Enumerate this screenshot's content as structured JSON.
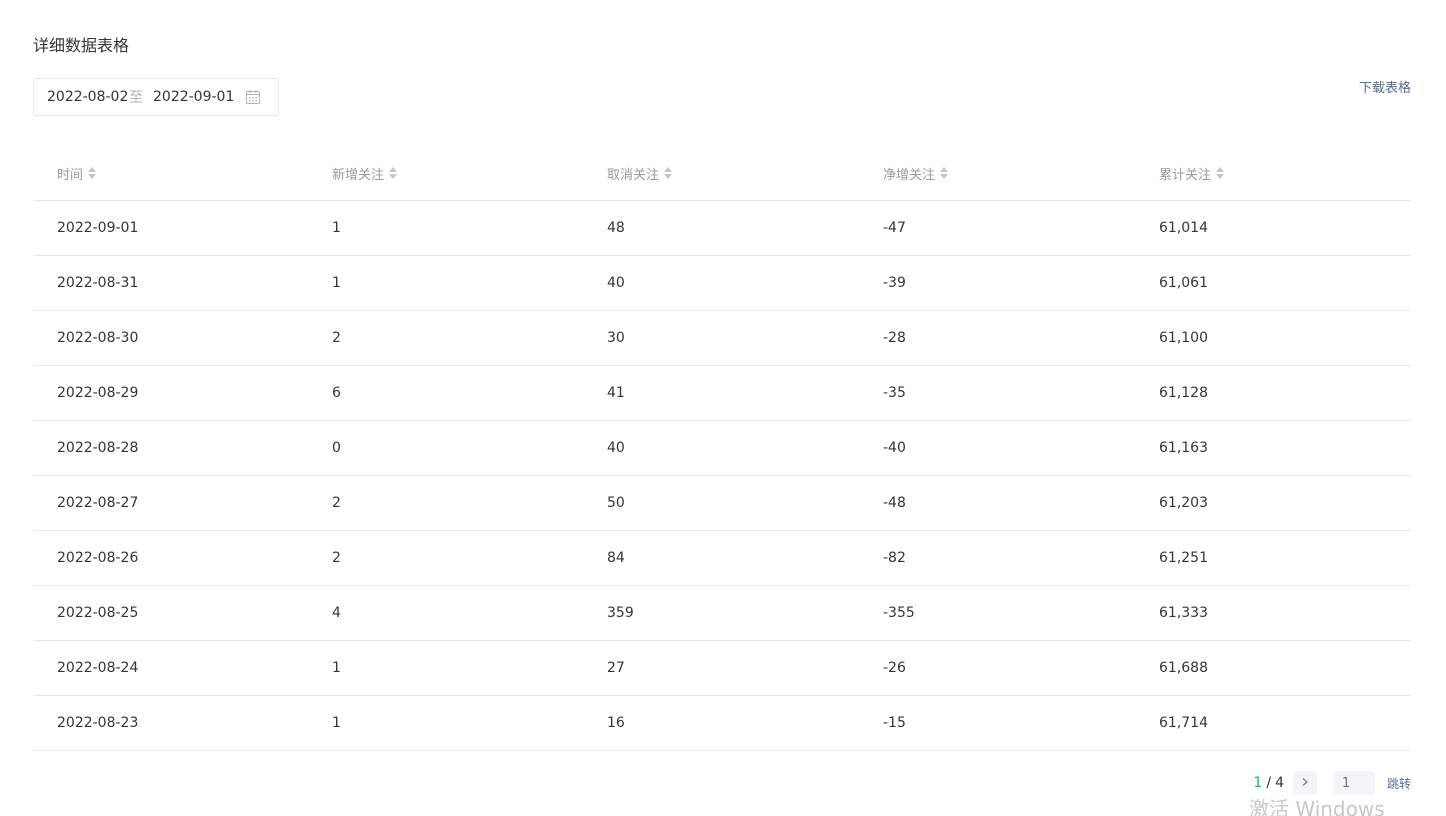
{
  "section": {
    "title": "详细数据表格"
  },
  "date_range": {
    "start": "2022-08-02",
    "separator": "至",
    "end": "2022-09-01",
    "icon": "calendar-icon"
  },
  "actions": {
    "download_label": "下载表格"
  },
  "table": {
    "columns": [
      "时间",
      "新增关注",
      "取消关注",
      "净增关注",
      "累计关注"
    ],
    "rows": [
      [
        "2022-09-01",
        "1",
        "48",
        "-47",
        "61,014"
      ],
      [
        "2022-08-31",
        "1",
        "40",
        "-39",
        "61,061"
      ],
      [
        "2022-08-30",
        "2",
        "30",
        "-28",
        "61,100"
      ],
      [
        "2022-08-29",
        "6",
        "41",
        "-35",
        "61,128"
      ],
      [
        "2022-08-28",
        "0",
        "40",
        "-40",
        "61,163"
      ],
      [
        "2022-08-27",
        "2",
        "50",
        "-48",
        "61,203"
      ],
      [
        "2022-08-26",
        "2",
        "84",
        "-82",
        "61,251"
      ],
      [
        "2022-08-25",
        "4",
        "359",
        "-355",
        "61,333"
      ],
      [
        "2022-08-24",
        "1",
        "27",
        "-26",
        "61,688"
      ],
      [
        "2022-08-23",
        "1",
        "16",
        "-15",
        "61,714"
      ]
    ]
  },
  "pagination": {
    "current": "1",
    "separator": "/",
    "total": "4",
    "input_placeholder": "1",
    "jump_label": "跳转"
  },
  "watermark": {
    "text": "激活 Windows"
  },
  "colors": {
    "accent_green": "#07c160",
    "link_blue": "#576b95",
    "divider": "#e7e7eb"
  }
}
